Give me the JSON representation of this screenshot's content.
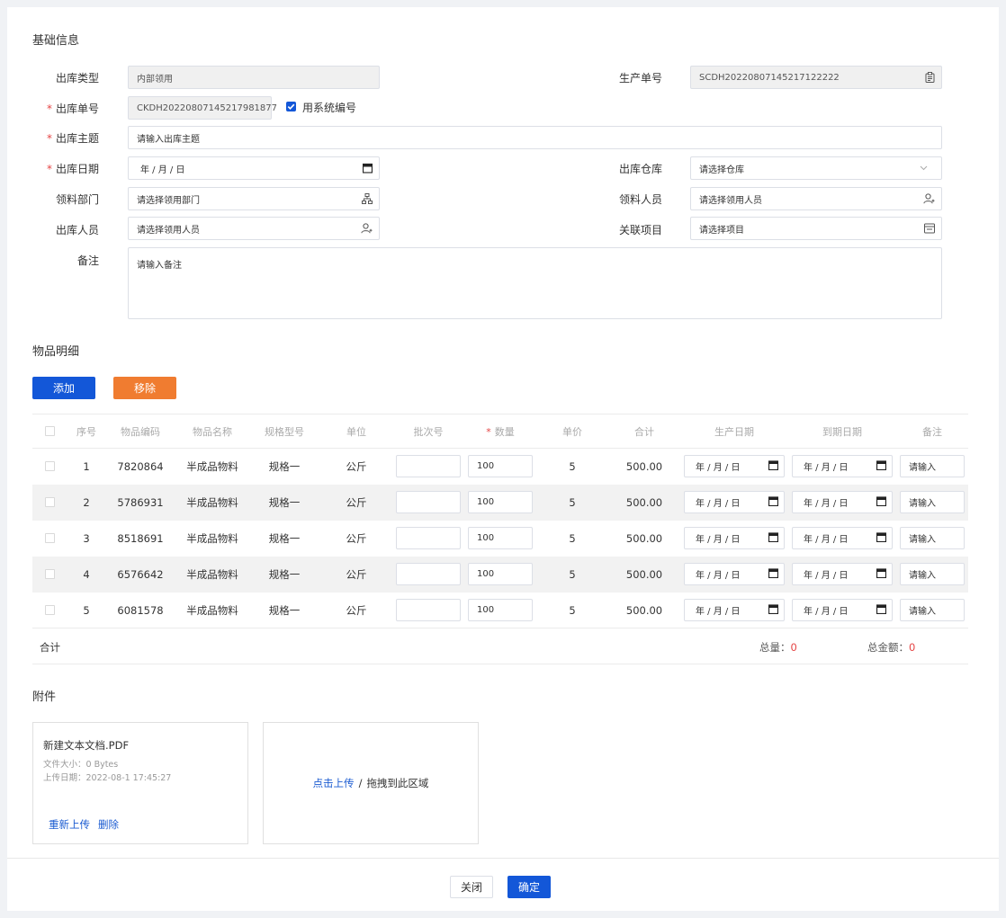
{
  "basic": {
    "title": "基础信息",
    "outbound_type": {
      "label": "出库类型",
      "value": "内部领用"
    },
    "production_no": {
      "label": "生产单号",
      "value": "SCDH20220807145217122222"
    },
    "outbound_no": {
      "label": "出库单号",
      "value": "CKDH20220807145217981877",
      "checkbox_label": "用系统编号"
    },
    "subject": {
      "label": "出库主题",
      "placeholder": "请输入出库主题"
    },
    "date": {
      "label": "出库日期",
      "placeholder": "年 / 月 / 日"
    },
    "warehouse": {
      "label": "出库仓库",
      "placeholder": "请选择仓库"
    },
    "dept": {
      "label": "领料部门",
      "placeholder": "请选择领用部门"
    },
    "receiver": {
      "label": "领料人员",
      "placeholder": "请选择领用人员"
    },
    "operator": {
      "label": "出库人员",
      "placeholder": "请选择领用人员"
    },
    "project": {
      "label": "关联项目",
      "placeholder": "请选择项目"
    },
    "remark": {
      "label": "备注",
      "placeholder": "请输入备注"
    }
  },
  "items": {
    "title": "物品明细",
    "add_label": "添加",
    "remove_label": "移除",
    "columns": [
      "序号",
      "物品编码",
      "物品名称",
      "规格型号",
      "单位",
      "批次号",
      "数量",
      "单价",
      "合计",
      "生产日期",
      "到期日期",
      "备注"
    ],
    "date_placeholder": "年 / 月 / 日",
    "remark_placeholder": "请输入",
    "rows": [
      {
        "no": "1",
        "code": "7820864",
        "name": "半成品物料",
        "spec": "规格一",
        "unit": "公斤",
        "qty": "100",
        "price": "5",
        "total": "500.00"
      },
      {
        "no": "2",
        "code": "5786931",
        "name": "半成品物料",
        "spec": "规格一",
        "unit": "公斤",
        "qty": "100",
        "price": "5",
        "total": "500.00"
      },
      {
        "no": "3",
        "code": "8518691",
        "name": "半成品物料",
        "spec": "规格一",
        "unit": "公斤",
        "qty": "100",
        "price": "5",
        "total": "500.00"
      },
      {
        "no": "4",
        "code": "6576642",
        "name": "半成品物料",
        "spec": "规格一",
        "unit": "公斤",
        "qty": "100",
        "price": "5",
        "total": "500.00"
      },
      {
        "no": "5",
        "code": "6081578",
        "name": "半成品物料",
        "spec": "规格一",
        "unit": "公斤",
        "qty": "100",
        "price": "5",
        "total": "500.00"
      }
    ],
    "summary_label": "合计",
    "total_qty_label": "总量：",
    "total_qty": "0",
    "total_amount_label": "总金额：",
    "total_amount": "0"
  },
  "attachment": {
    "title": "附件",
    "file_name": "新建文本文档.PDF",
    "file_size": "文件大小：0 Bytes",
    "upload_date": "上传日期：2022-08-1 17:45:27",
    "reupload": "重新上传",
    "delete": "删除",
    "upload_link": "点击上传",
    "upload_sep": "/",
    "upload_hint": "拖拽到此区域"
  },
  "footer": {
    "close": "关闭",
    "confirm": "确定"
  }
}
